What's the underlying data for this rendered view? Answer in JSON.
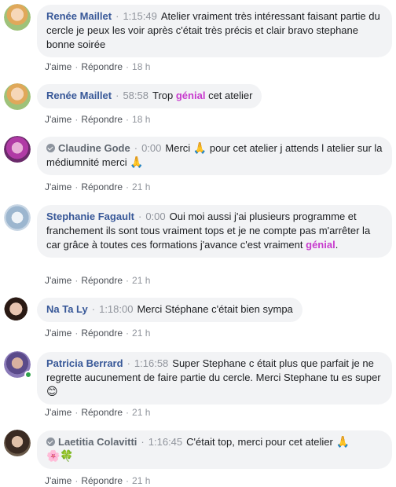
{
  "comments": [
    {
      "author": "Renée Maillet",
      "verified": false,
      "timestamp": "1:15:49",
      "text_parts": [
        "Atelier vraiment très intéressant faisant partie du cercle je peux les voir après c'était très précis et clair bravo stephane bonne soirée"
      ],
      "like": "J'aime",
      "reply": "Répondre",
      "age": "18 h",
      "avatar_color": "#d7a14a"
    },
    {
      "author": "Renée Maillet",
      "verified": false,
      "timestamp": "58:58",
      "text_before": "Trop",
      "highlight": "génial",
      "text_after": "cet atelier",
      "like": "J'aime",
      "reply": "Répondre",
      "age": "18 h",
      "avatar_color": "#d7a14a"
    },
    {
      "author": "Claudine Gode",
      "verified": true,
      "timestamp": "0:00",
      "text_before": "Merci",
      "emoji": "🙏",
      "text_after": "pour cet atelier j attends l atelier sur la médiumnité merci",
      "emoji_end": "🙏",
      "like": "J'aime",
      "reply": "Répondre",
      "age": "21 h",
      "avatar_color": "#b03aa5"
    },
    {
      "author": "Stephanie Fagault",
      "verified": false,
      "timestamp": "0:00",
      "text_before": "Oui moi aussi j'ai plusieurs programme et franchement ils sont tous vraiment tops et je ne compte pas m'arrêter la car grâce à toutes ces formations j'avance c'est vraiment",
      "highlight": "génial",
      "text_after": ".",
      "like": "J'aime",
      "reply": "Répondre",
      "age": "21 h",
      "avatar_color": "#9cb6cf"
    },
    {
      "author": "Na Ta Ly",
      "verified": false,
      "timestamp": "1:18:00",
      "text": "Merci Stéphane c'était bien sympa",
      "like": "J'aime",
      "reply": "Répondre",
      "age": "21 h",
      "avatar_color": "#8a5a48"
    },
    {
      "author": "Patricia Berrard",
      "verified": false,
      "timestamp": "1:16:58",
      "text": "Super Stephane c était plus que parfait je ne regrette aucunement de faire partie du cercle. Merci Stephane tu es super",
      "emoji": "😊",
      "online": true,
      "like": "J'aime",
      "reply": "Répondre",
      "age": "21 h",
      "avatar_color": "#5a4a8a"
    },
    {
      "author": "Laetitia Colavitti",
      "verified": true,
      "timestamp": "1:16:45",
      "text": "C'était top, merci pour cet atelier",
      "emoji": "🙏",
      "emoji_line2": "🌸🍀",
      "like": "J'aime",
      "reply": "Répondre",
      "age": "21 h",
      "avatar_color": "#3a2a22"
    }
  ],
  "separator": "·"
}
